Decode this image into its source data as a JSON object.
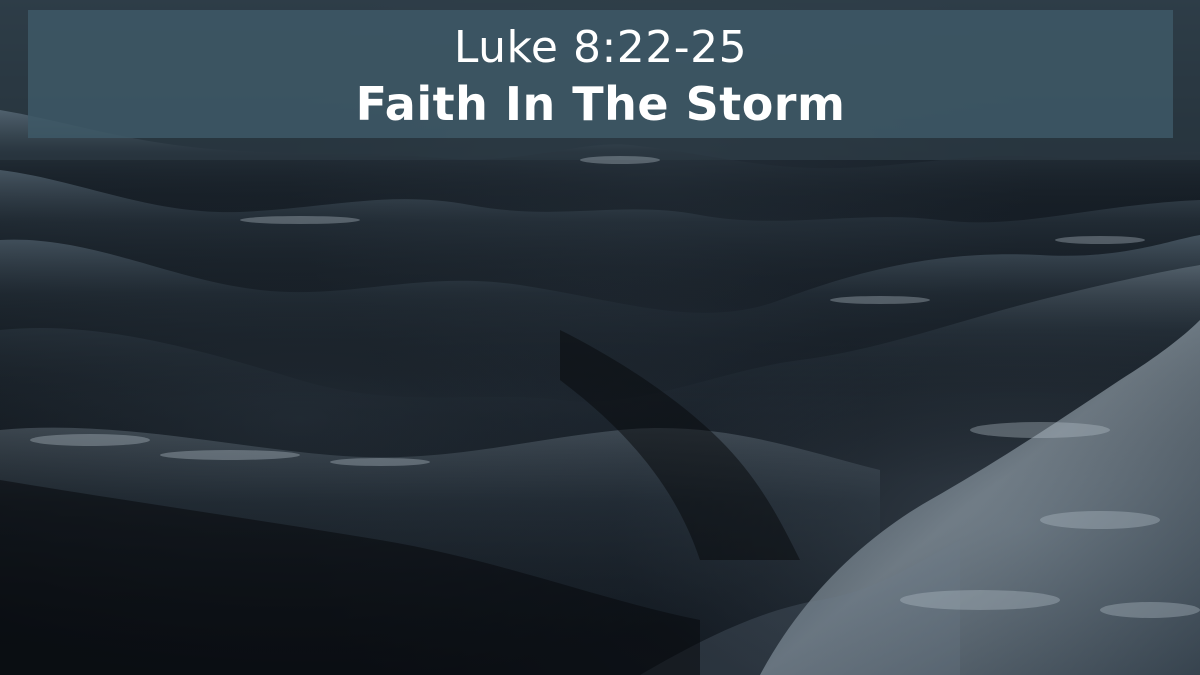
{
  "slide": {
    "scripture_reference": "Luke 8:22-25",
    "sermon_title": "Faith In The Storm"
  },
  "colors": {
    "banner": "#3e5866",
    "text": "#ffffff",
    "background": "#0e141a"
  }
}
